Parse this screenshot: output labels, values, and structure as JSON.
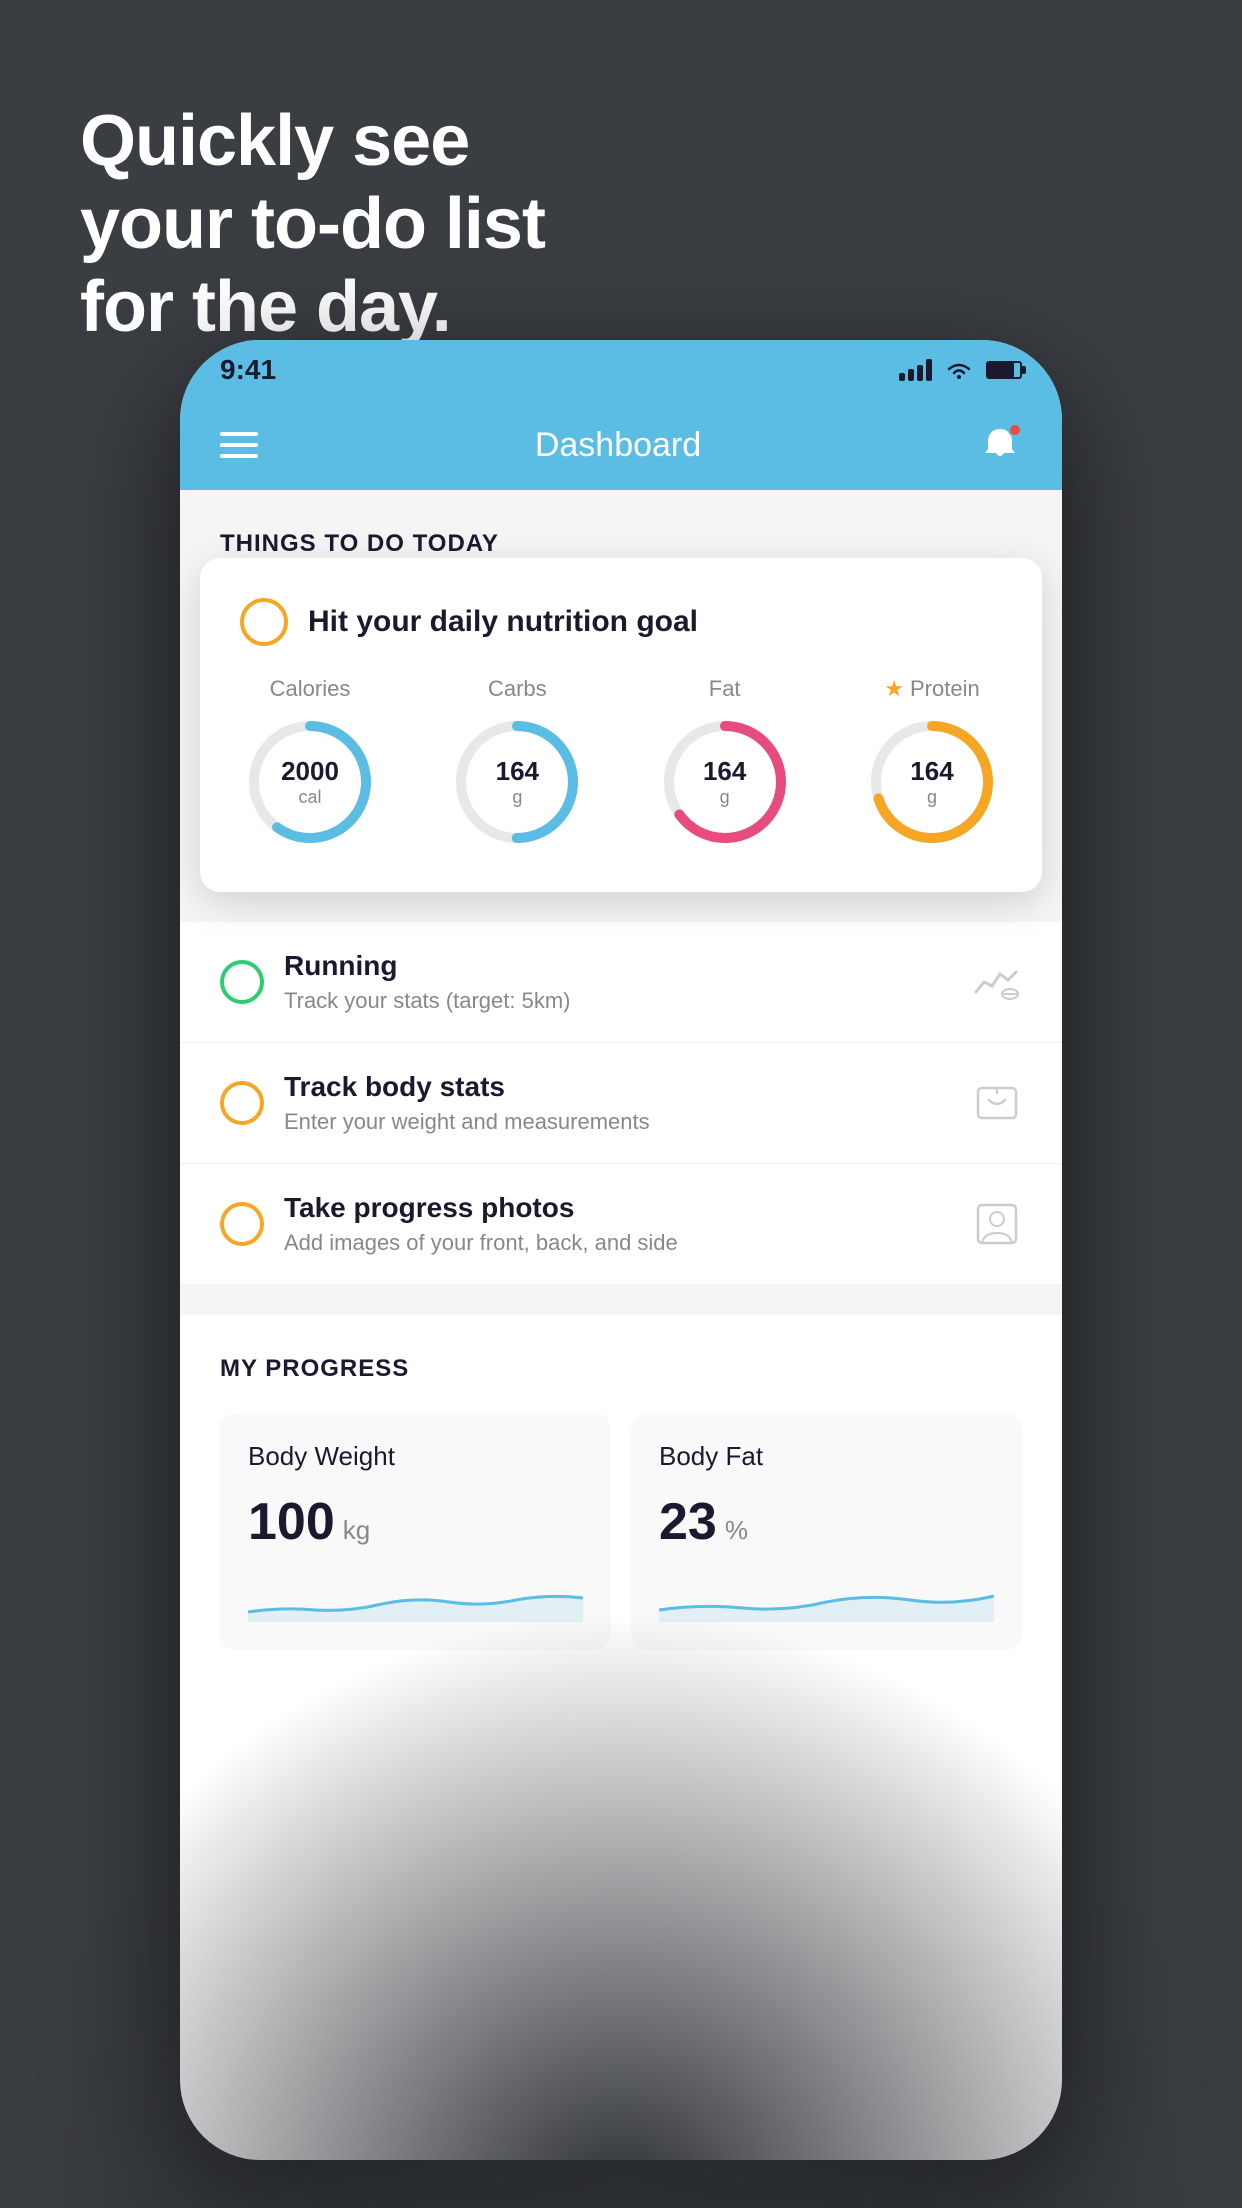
{
  "headline": {
    "line1": "Quickly see",
    "line2": "your to-do list",
    "line3": "for the day."
  },
  "status_bar": {
    "time": "9:41"
  },
  "header": {
    "title": "Dashboard"
  },
  "things_to_do": {
    "section_title": "THINGS TO DO TODAY",
    "floating_card": {
      "checkbox_color": "yellow",
      "title": "Hit your daily nutrition goal",
      "nutrition": [
        {
          "label": "Calories",
          "value": "2000",
          "unit": "cal",
          "color": "#5bbde4",
          "progress": 0.6
        },
        {
          "label": "Carbs",
          "value": "164",
          "unit": "g",
          "color": "#5bbde4",
          "progress": 0.5
        },
        {
          "label": "Fat",
          "value": "164",
          "unit": "g",
          "color": "#e74c7c",
          "progress": 0.65
        },
        {
          "label": "Protein",
          "value": "164",
          "unit": "g",
          "color": "#f5a623",
          "progress": 0.7,
          "starred": true
        }
      ]
    },
    "todo_items": [
      {
        "id": "running",
        "checkbox_color": "green",
        "title": "Running",
        "subtitle": "Track your stats (target: 5km)",
        "icon": "shoe"
      },
      {
        "id": "body-stats",
        "checkbox_color": "yellow",
        "title": "Track body stats",
        "subtitle": "Enter your weight and measurements",
        "icon": "scale"
      },
      {
        "id": "progress-photos",
        "checkbox_color": "yellow",
        "title": "Take progress photos",
        "subtitle": "Add images of your front, back, and side",
        "icon": "person"
      }
    ]
  },
  "progress": {
    "section_title": "MY PROGRESS",
    "cards": [
      {
        "id": "body-weight",
        "title": "Body Weight",
        "value": "100",
        "unit": "kg"
      },
      {
        "id": "body-fat",
        "title": "Body Fat",
        "value": "23",
        "unit": "%"
      }
    ]
  },
  "colors": {
    "primary": "#5bbde4",
    "accent_yellow": "#f5a623",
    "accent_red": "#e74c7c",
    "dark": "#1a1a2e",
    "background": "#3a3d42"
  }
}
